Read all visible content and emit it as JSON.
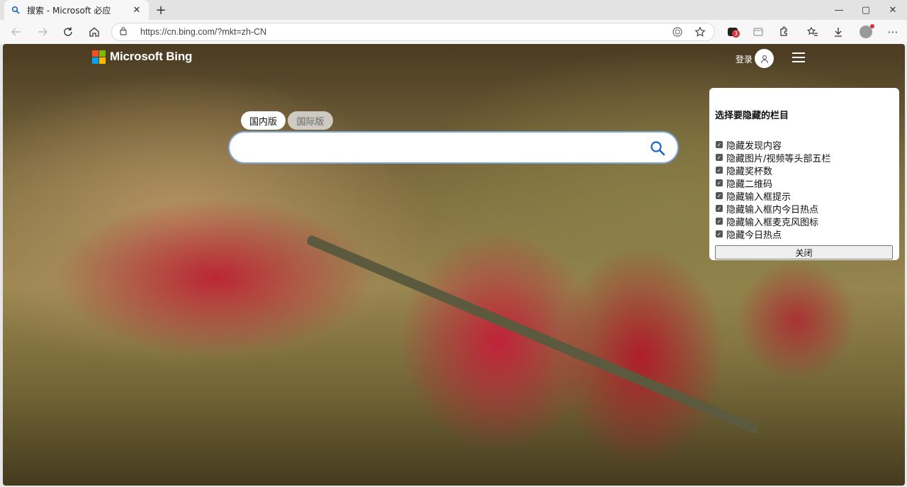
{
  "browser": {
    "tab": {
      "title": "搜索 - Microsoft 必应",
      "close_glyph": "✕"
    },
    "new_tab_glyph": "+",
    "window": {
      "minimize": "—",
      "maximize": "▢",
      "close": "✕"
    },
    "address": {
      "url": "https://cn.bing.com/?mkt=zh-CN"
    },
    "extensions_badge": "3"
  },
  "page": {
    "logo_text": "Microsoft Bing",
    "logo_colors": [
      "#f25022",
      "#7fba00",
      "#00a4ef",
      "#ffb900"
    ],
    "login_label": "登录",
    "scope_tabs": [
      {
        "label": "国内版",
        "active": true
      },
      {
        "label": "国际版",
        "active": false
      }
    ],
    "search": {
      "value": "",
      "placeholder": ""
    },
    "accent": "#1b63c6"
  },
  "panel": {
    "title": "选择要隐藏的栏目",
    "options": [
      {
        "label": "隐藏发现内容",
        "checked": true
      },
      {
        "label": "隐藏图片/视频等头部五栏",
        "checked": true
      },
      {
        "label": "隐藏奖杯数",
        "checked": true
      },
      {
        "label": "隐藏二维码",
        "checked": true
      },
      {
        "label": "隐藏输入框提示",
        "checked": true
      },
      {
        "label": "隐藏输入框内今日热点",
        "checked": true
      },
      {
        "label": "隐藏输入框麦克风图标",
        "checked": true
      },
      {
        "label": "隐藏今日热点",
        "checked": true
      }
    ],
    "close_label": "关闭"
  }
}
